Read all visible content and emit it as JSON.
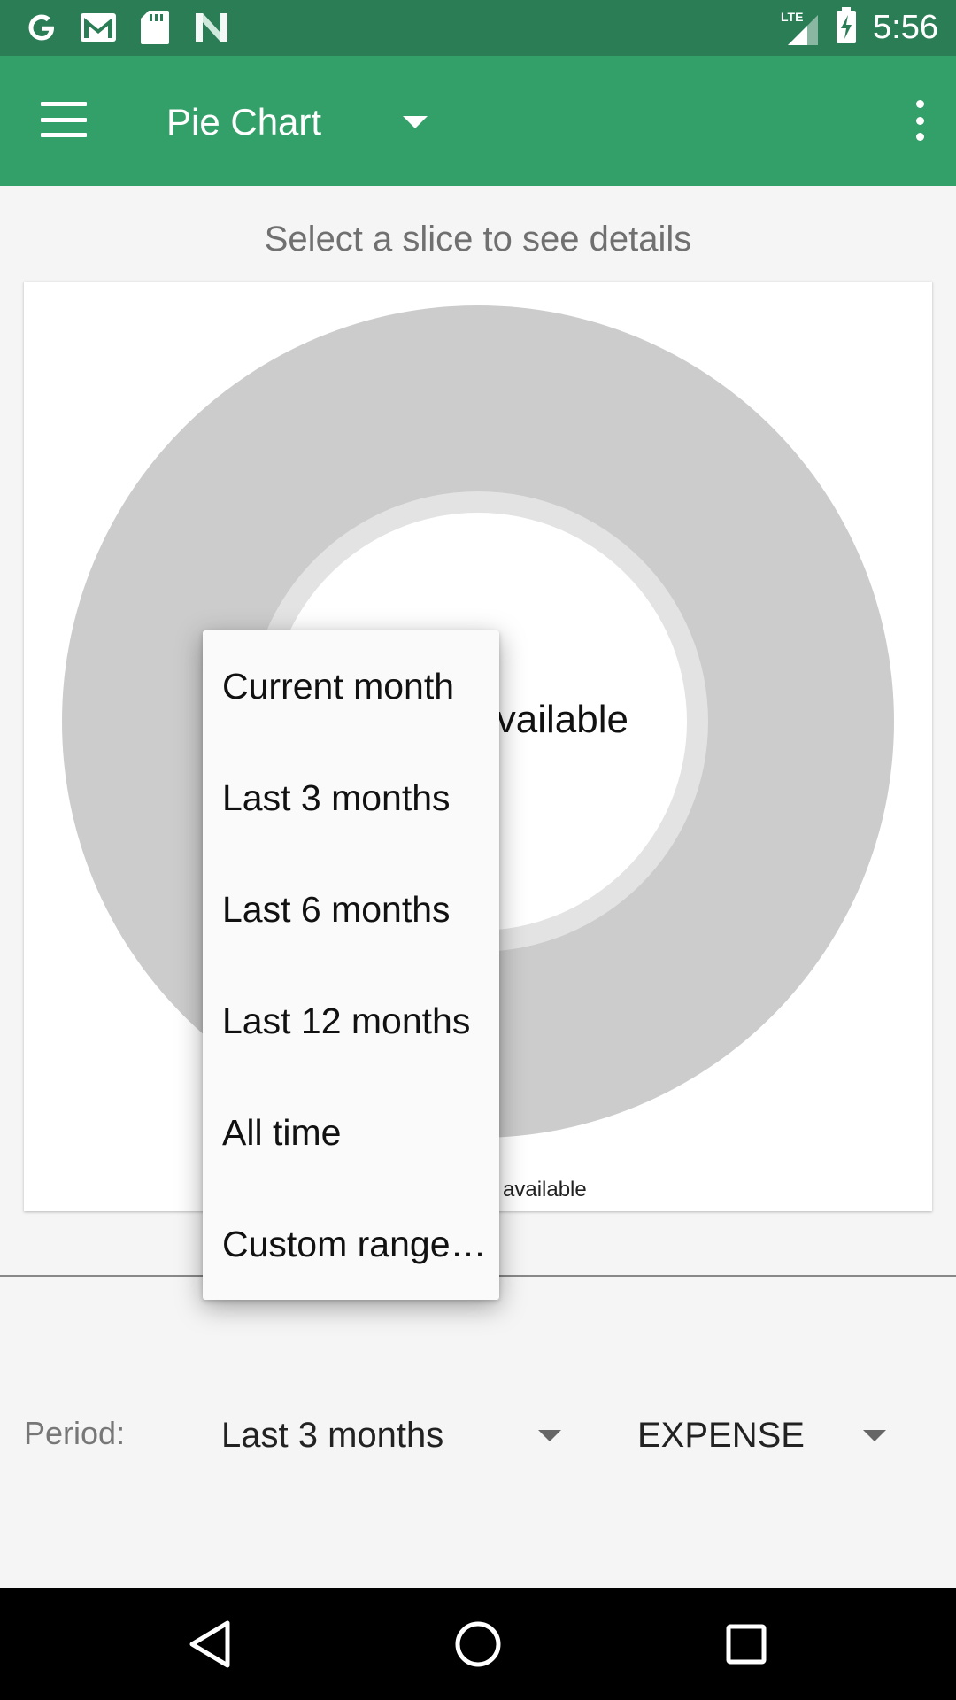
{
  "status_bar": {
    "time": "5:56",
    "network": "LTE",
    "notification_icons": [
      "google-icon",
      "gmail-icon",
      "sd-card-icon",
      "n-app-icon"
    ]
  },
  "app_bar": {
    "title": "Pie Chart"
  },
  "main": {
    "hint": "Select a slice to see details",
    "center_text": "No data available",
    "bottom_text": "No chart data available"
  },
  "controls": {
    "period_label": "Period:",
    "period_value": "Last 3 months",
    "type_value": "EXPENSE"
  },
  "period_menu": {
    "items": [
      {
        "label": "Current month"
      },
      {
        "label": "Last 3 months"
      },
      {
        "label": "Last 6 months"
      },
      {
        "label": "Last 12 months"
      },
      {
        "label": "All time"
      },
      {
        "label": "Custom range…"
      }
    ]
  },
  "colors": {
    "status_bar": "#2a7d55",
    "app_bar": "#33a069",
    "empty_ring": "#cccccc",
    "inner_ring": "#e3e3e3"
  }
}
